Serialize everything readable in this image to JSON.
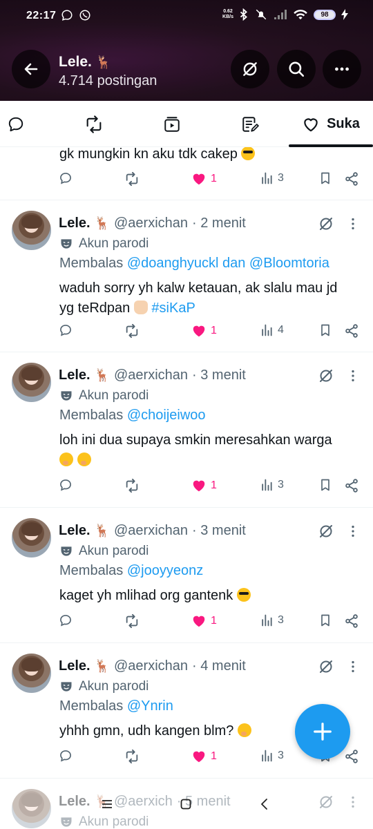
{
  "status_bar": {
    "time": "22:17",
    "speed_value": "0.62",
    "speed_unit": "KB/s",
    "battery": "98"
  },
  "header": {
    "title": "Lele.",
    "title_emoji": "🦌",
    "subtitle": "4.714 postingan"
  },
  "tabs": {
    "likes_label": "Suka"
  },
  "feed": {
    "partial_post": {
      "text": "gk mungkin kn aku tdk cakep",
      "likes": "1",
      "views": "3"
    },
    "posts": [
      {
        "name": "Lele.",
        "name_emoji": "🦌",
        "handle": "@aerxichan",
        "time": "· 2 menit",
        "parody": "Akun parodi",
        "reply_prefix": "Membalas",
        "reply_to": "@doanghyuckl dan @Bloomtoria",
        "text_line1": "waduh sorry yh kalw ketauan, ak slalu mau jd",
        "text_line2": "yg teRdpan",
        "hashtag": "#siKaP",
        "likes": "1",
        "views": "4"
      },
      {
        "name": "Lele.",
        "name_emoji": "🦌",
        "handle": "@aerxichan",
        "time": "· 3 menit",
        "parody": "Akun parodi",
        "reply_prefix": "Membalas",
        "reply_to": "@choijeiwoo",
        "text_line1": "loh ini dua supaya smkin meresahkan warga",
        "likes": "1",
        "views": "3"
      },
      {
        "name": "Lele.",
        "name_emoji": "🦌",
        "handle": "@aerxichan",
        "time": "· 3 menit",
        "parody": "Akun parodi",
        "reply_prefix": "Membalas",
        "reply_to": "@jooyyeonz",
        "text_line1": "kaget yh mlihad org gantenk",
        "likes": "1",
        "views": "3"
      },
      {
        "name": "Lele.",
        "name_emoji": "🦌",
        "handle": "@aerxichan",
        "time": "· 4 menit",
        "parody": "Akun parodi",
        "reply_prefix": "Membalas",
        "reply_to": "@Ynrin",
        "text_line1": "yhhh gmn, udh kangen blm?",
        "likes": "1",
        "views": "3"
      },
      {
        "name": "Lele.",
        "name_emoji": "🦌",
        "handle": "@aerxich",
        "time": "· 5 menit",
        "parody": "Akun parodi"
      }
    ]
  },
  "colors": {
    "accent": "#1d9bf0",
    "like": "#f91880",
    "muted": "#536471"
  },
  "icons": [
    "back-arrow-icon",
    "grok-icon",
    "search-icon",
    "more-icon",
    "reply-icon",
    "retweet-icon",
    "media-icon",
    "article-icon",
    "heart-icon",
    "views-icon",
    "bookmark-icon",
    "share-icon",
    "plus-icon",
    "parody-mask-icon"
  ]
}
